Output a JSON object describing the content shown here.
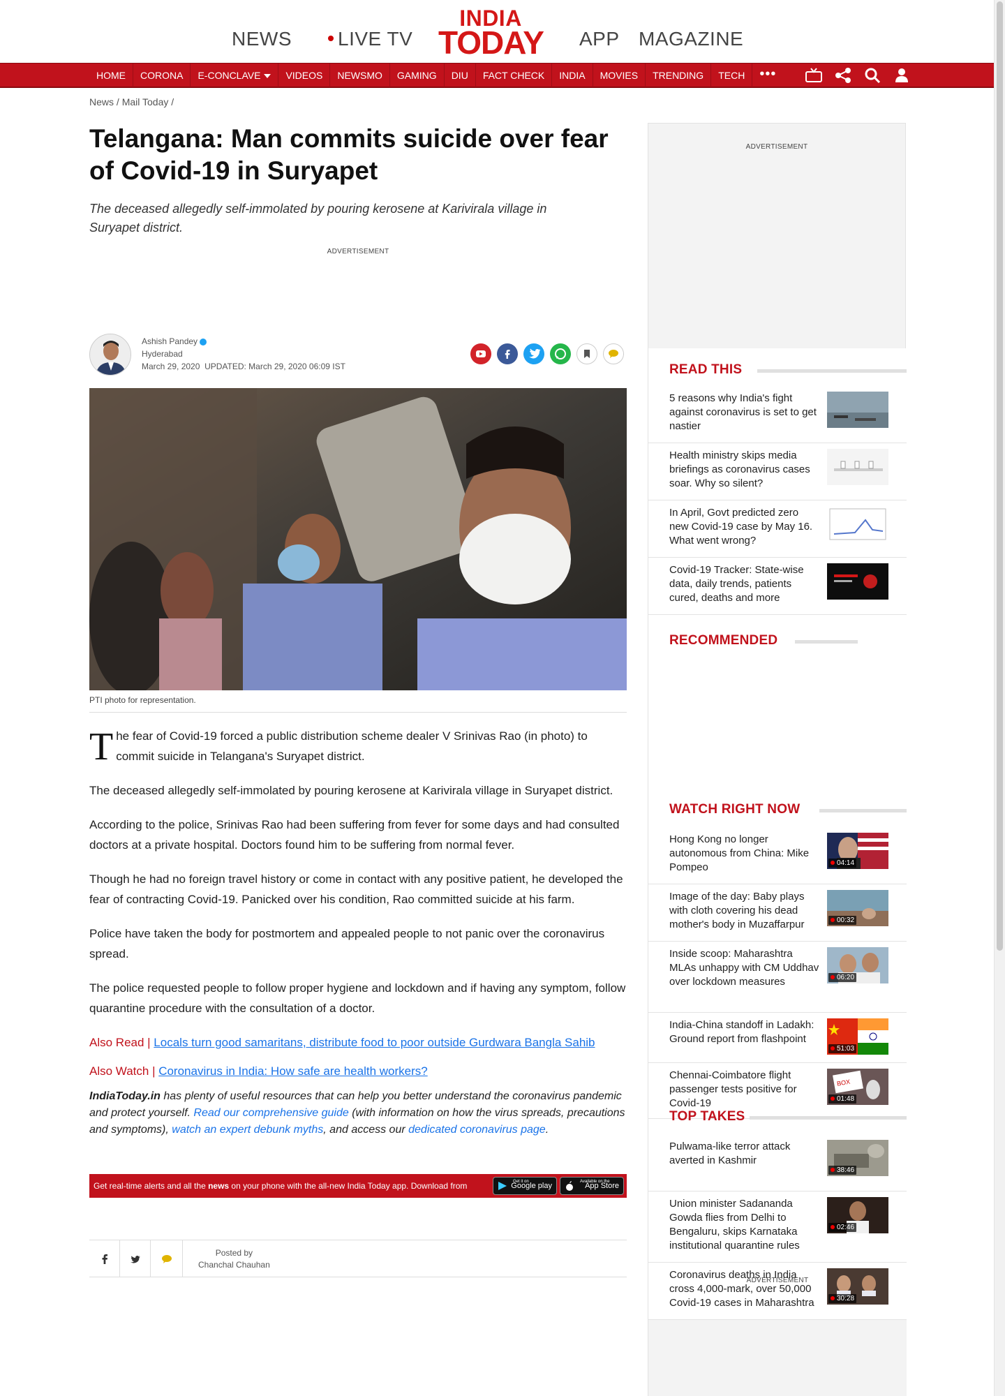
{
  "site": {
    "logo_line1": "INDIA",
    "logo_line2": "TODAY",
    "brand_color": "#c1121c"
  },
  "topnav": {
    "news": "NEWS",
    "live_tv": "LIVE TV",
    "app": "APP",
    "magazine": "MAGAZINE"
  },
  "rednav": {
    "items": [
      "HOME",
      "CORONA",
      "E-CONCLAVE",
      "VIDEOS",
      "NEWSMO",
      "GAMING",
      "DIU",
      "FACT CHECK",
      "INDIA",
      "MOVIES",
      "TRENDING",
      "TECH"
    ],
    "more": "•••",
    "icons": [
      "tv-icon",
      "share-icon",
      "search-icon",
      "user-icon"
    ]
  },
  "breadcrumb": [
    "News /",
    "Mail Today /"
  ],
  "article": {
    "headline": "Telangana: Man commits suicide over fear of Covid-19 in Suryapet",
    "summary": "The deceased allegedly self-immolated by pouring kerosene at Karivirala village in Suryapet district.",
    "ad_label": "ADVERTISEMENT",
    "author": "Ashish Pandey",
    "location": "Hyderabad",
    "date": "March 29, 2020",
    "updated": "UPDATED: March 29, 2020 06:09 IST",
    "caption": "PTI photo for representation.",
    "dropcap": "T",
    "para1": "he fear of Covid-19 forced a public distribution scheme dealer V Srinivas Rao (in photo) to commit suicide in Telangana's Suryapet district.",
    "para2": "The deceased allegedly self-immolated by pouring kerosene at Karivirala village in Suryapet district.",
    "para3": "According to the police, Srinivas Rao had been suffering from fever for some days and had consulted doctors at a private hospital. Doctors found him to be suffering from normal fever.",
    "para4": "Though he had no foreign travel history or come in contact with any positive patient, he developed the fear of contracting Covid-19. Panicked over his condition, Rao committed suicide at his farm.",
    "para5": "Police have taken the body for postmortem and appealed people to not panic over the coronavirus spread.",
    "para6": "The police requested people to follow proper hygiene and lockdown and if having any symptom, follow quarantine procedure with the consultation of a doctor.",
    "also_read_label": "Also Read | ",
    "also_read_link": "Locals turn good samaritans, distribute food to poor outside Gurdwara Bangla Sahib",
    "also_watch_label": "Also Watch | ",
    "also_watch_link": "Coronavirus in India: How safe are health workers?",
    "note_brand": "IndiaToday.in",
    "note_text1": " has plenty of useful resources that can help you better understand the coronavirus pandemic and protect yourself. ",
    "note_link1": "Read our comprehensive guide",
    "note_text2": " (with information on how the virus spreads, precautions and symptoms), ",
    "note_link2": "watch an expert debunk myths",
    "note_text3": ", and access our ",
    "note_link3": "dedicated coronavirus page",
    "note_text4": "."
  },
  "app_banner": {
    "text_before": "Get real-time alerts and all the ",
    "text_bold": "news",
    "text_after": " on your phone with the all-new India Today app. Download from",
    "google_sub": "Get it on",
    "google": "Google play",
    "apple_sub": "Available on the",
    "apple": "App Store"
  },
  "post_footer": {
    "posted_by_label": "Posted by",
    "posted_by": "Chanchal Chauhan",
    "icons": [
      "facebook-icon",
      "twitter-icon",
      "comment-icon"
    ]
  },
  "sidebar": {
    "ad_label": "ADVERTISEMENT",
    "read_this": {
      "title": "READ THIS",
      "items": [
        "5 reasons why India's fight against coronavirus is set to get nastier",
        "Health ministry skips media briefings as coronavirus cases soar. Why so silent?",
        "In April, Govt predicted zero new Covid-19 case by May 16. What went wrong?",
        "Covid-19 Tracker: State-wise data, daily trends, patients cured, deaths and more"
      ]
    },
    "recommended": {
      "title": "RECOMMENDED"
    },
    "watch_right_now": {
      "title": "WATCH RIGHT NOW",
      "items": [
        {
          "title": "Hong Kong no longer autonomous from China: Mike Pompeo",
          "duration": "04:14"
        },
        {
          "title": "Image of the day: Baby plays with cloth covering his dead mother's body in Muzaffarpur",
          "duration": "00:32"
        },
        {
          "title": "Inside scoop: Maharashtra MLAs unhappy with CM Uddhav over lockdown measures",
          "duration": "06:20"
        },
        {
          "title": "India-China standoff in Ladakh: Ground report from flashpoint",
          "duration": "51:03"
        },
        {
          "title": "Chennai-Coimbatore flight passenger tests positive for Covid-19",
          "duration": "01:48"
        }
      ]
    },
    "top_takes": {
      "title": "TOP TAKES",
      "items": [
        {
          "title": "Pulwama-like terror attack averted in Kashmir",
          "duration": "38:46"
        },
        {
          "title": "Union minister Sadananda Gowda flies from Delhi to Bengaluru, skips Karnataka institutional quarantine rules",
          "duration": "02:46"
        },
        {
          "title": "Coronavirus deaths in India cross 4,000-mark, over 50,000 Covid-19 cases in Maharashtra",
          "duration": "30:28"
        }
      ]
    },
    "ad_bottom_label": "ADVERTISEMENT"
  }
}
